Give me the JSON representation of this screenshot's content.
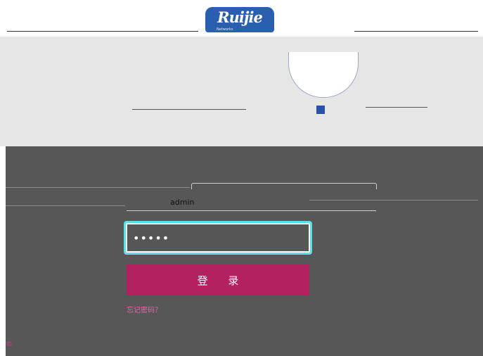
{
  "header": {
    "brand": "Ruijie",
    "brand_sub": "Networks"
  },
  "login": {
    "username_value": "admin",
    "password_value": "•••••",
    "login_label": "登 录",
    "forgot_label": "忘记密码？"
  },
  "colors": {
    "brand_blue": "#2a5fb0",
    "login_button": "#b32160",
    "focus_ring": "#5ce0e8",
    "notice_orange": "#f17a3a"
  }
}
